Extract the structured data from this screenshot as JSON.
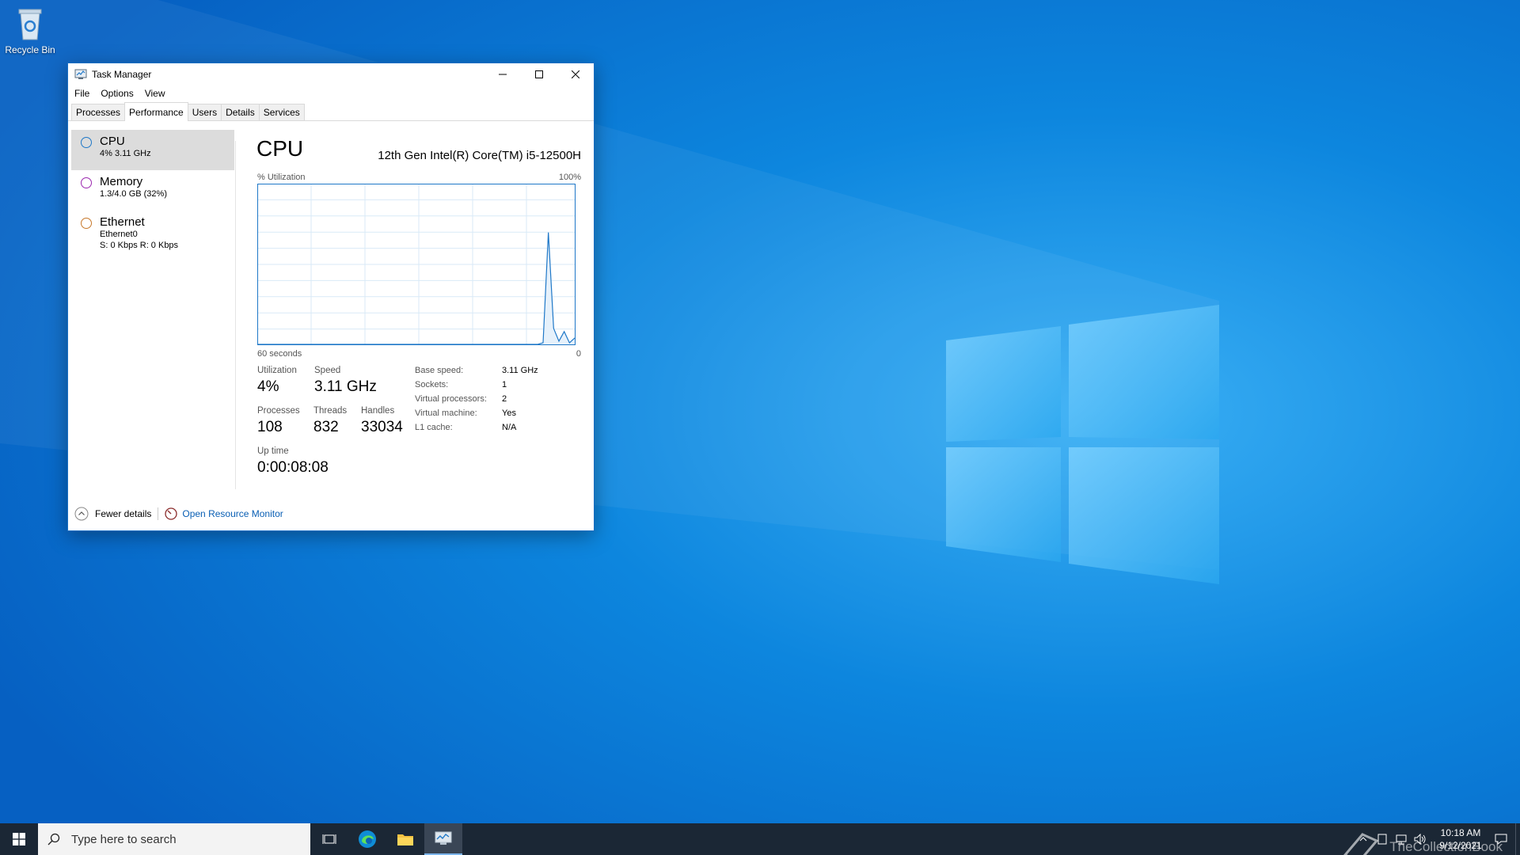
{
  "desktop": {
    "icons": [
      {
        "label": "Recycle Bin",
        "icon": "recycle-bin-icon"
      }
    ]
  },
  "window": {
    "title": "Task Manager",
    "menu": [
      "File",
      "Options",
      "View"
    ],
    "tabs": [
      "Processes",
      "Performance",
      "Users",
      "Details",
      "Services"
    ],
    "active_tab": "Performance",
    "resources": [
      {
        "name": "CPU",
        "sub1": "4% 3.11 GHz",
        "sub2": "",
        "color": "#1f78c8"
      },
      {
        "name": "Memory",
        "sub1": "1.3/4.0 GB (32%)",
        "sub2": "",
        "color": "#9b27af"
      },
      {
        "name": "Ethernet",
        "sub1": "Ethernet0",
        "sub2": "S: 0 Kbps R: 0 Kbps",
        "color": "#c7782b"
      }
    ],
    "cpu": {
      "title": "CPU",
      "model": "12th Gen Intel(R) Core(TM) i5-12500H",
      "util_label": "% Utilization",
      "util_max": "100%",
      "time_label": "60 seconds",
      "time_zero": "0",
      "stats": {
        "utilization": {
          "label": "Utilization",
          "value": "4%"
        },
        "speed": {
          "label": "Speed",
          "value": "3.11 GHz"
        },
        "processes": {
          "label": "Processes",
          "value": "108"
        },
        "threads": {
          "label": "Threads",
          "value": "832"
        },
        "handles": {
          "label": "Handles",
          "value": "33034"
        },
        "uptime": {
          "label": "Up time",
          "value": "0:00:08:08"
        }
      },
      "specs": [
        {
          "k": "Base speed:",
          "v": "3.11 GHz"
        },
        {
          "k": "Sockets:",
          "v": "1"
        },
        {
          "k": "Virtual processors:",
          "v": "2"
        },
        {
          "k": "Virtual machine:",
          "v": "Yes"
        },
        {
          "k": "L1 cache:",
          "v": "N/A"
        }
      ]
    },
    "footer": {
      "fewer_details": "Fewer details",
      "open_monitor": "Open Resource Monitor"
    }
  },
  "chart_data": {
    "type": "line",
    "x": [
      0,
      1,
      2,
      3,
      4,
      5,
      6,
      7,
      8,
      9,
      10,
      11,
      12,
      13,
      14,
      15,
      16,
      17,
      18,
      19,
      20,
      21,
      22,
      23,
      24,
      25,
      26,
      27,
      28,
      29,
      30,
      31,
      32,
      33,
      34,
      35,
      36,
      37,
      38,
      39,
      40,
      41,
      42,
      43,
      44,
      45,
      46,
      47,
      48,
      49,
      50,
      51,
      52,
      53,
      54,
      55,
      56,
      57,
      58,
      59,
      60
    ],
    "series": [
      {
        "values": [
          0,
          0,
          0,
          0,
          0,
          0,
          0,
          0,
          0,
          0,
          0,
          0,
          0,
          0,
          0,
          0,
          0,
          0,
          0,
          0,
          0,
          0,
          0,
          0,
          0,
          0,
          0,
          0,
          0,
          0,
          0,
          0,
          0,
          0,
          0,
          0,
          0,
          0,
          0,
          0,
          0,
          0,
          0,
          0,
          0,
          0,
          0,
          0,
          0,
          0,
          0,
          0,
          0,
          0,
          1,
          70,
          10,
          2,
          8,
          1,
          4
        ]
      }
    ],
    "ylim": [
      0,
      100
    ],
    "xlim": [
      0,
      60
    ],
    "grid": true,
    "color": "#1f78c8"
  },
  "taskbar": {
    "search_placeholder": "Type here to search",
    "apps": [
      "task-view-icon",
      "edge-icon",
      "file-explorer-icon",
      "task-manager-icon"
    ],
    "clock_time": "10:18 AM",
    "clock_date": "9/12/2021",
    "watermark": "TheCollectionBook"
  }
}
